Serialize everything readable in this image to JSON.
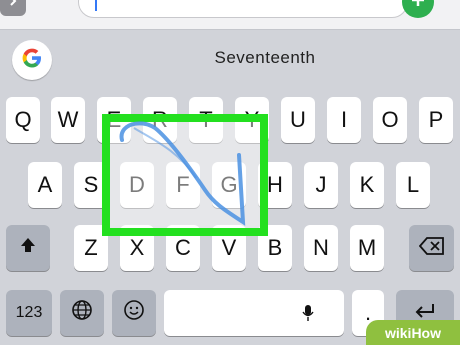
{
  "input": {
    "value": ""
  },
  "suggestion": {
    "text": "Seventeenth"
  },
  "keys": {
    "row1": [
      "Q",
      "W",
      "E",
      "R",
      "T",
      "Y",
      "U",
      "I",
      "O",
      "P"
    ],
    "row2": [
      "A",
      "S",
      "D",
      "F",
      "G",
      "H",
      "J",
      "K",
      "L"
    ],
    "row3": [
      "Z",
      "X",
      "C",
      "V",
      "B",
      "N",
      "M"
    ],
    "numbers_label": "123",
    "period_label": "."
  },
  "watermark": {
    "text": "wikiHow"
  },
  "icons": {
    "top_left": "chevron-right-icon",
    "send": "plus-icon",
    "google": "google-g-icon",
    "shift": "shift-icon",
    "delete": "delete-icon",
    "globe": "globe-icon",
    "emoji": "emoji-icon",
    "mic": "microphone-icon",
    "return": "return-icon"
  },
  "colors": {
    "highlight_box": "#23e01f",
    "swipe_trail": "#4a90e2",
    "send_button": "#2eaf4f",
    "watermark": "#8fc03f"
  }
}
